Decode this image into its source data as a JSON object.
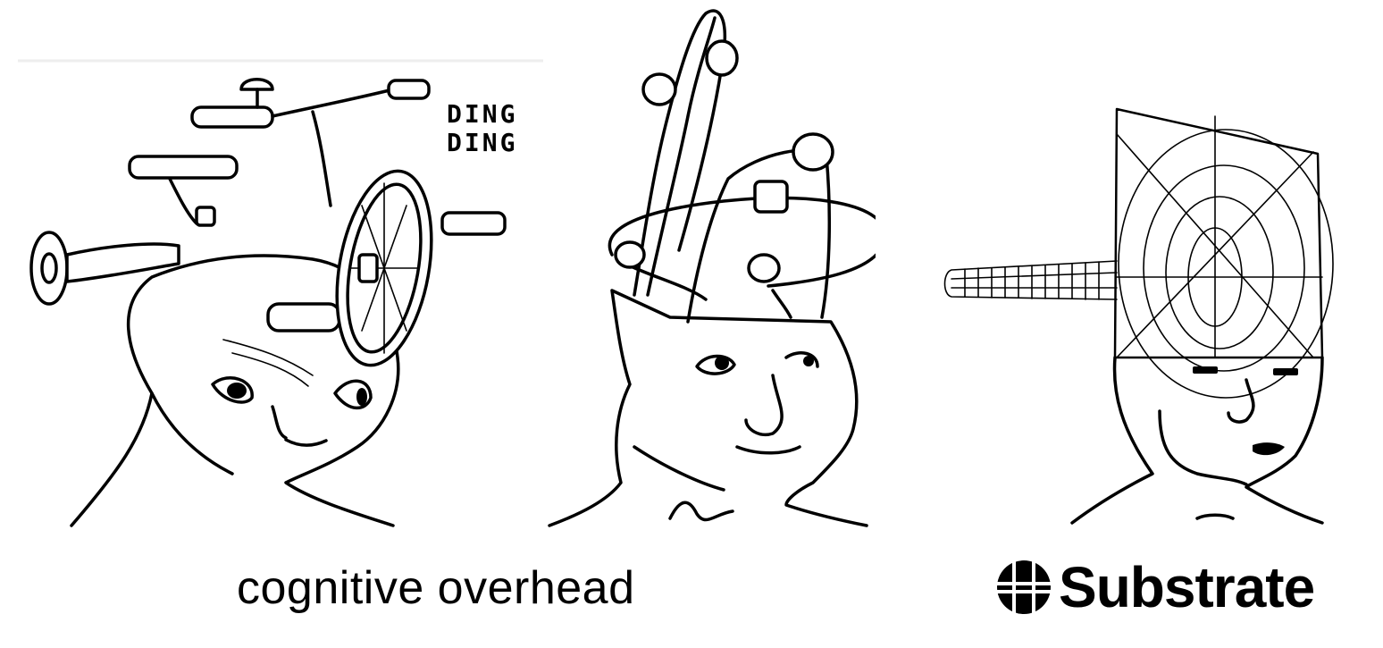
{
  "panels": [
    {
      "name": "wojak-bicycle-head",
      "annotation": "DING\nDING"
    },
    {
      "name": "wojak-tangled-head"
    },
    {
      "name": "wojak-wormhole-head"
    }
  ],
  "caption": "cognitive overhead",
  "brand": {
    "name": "Substrate",
    "icon": "substrate-logo-icon"
  },
  "colors": {
    "ink": "#000000",
    "background": "#ffffff",
    "divider": "#eeeeee"
  }
}
